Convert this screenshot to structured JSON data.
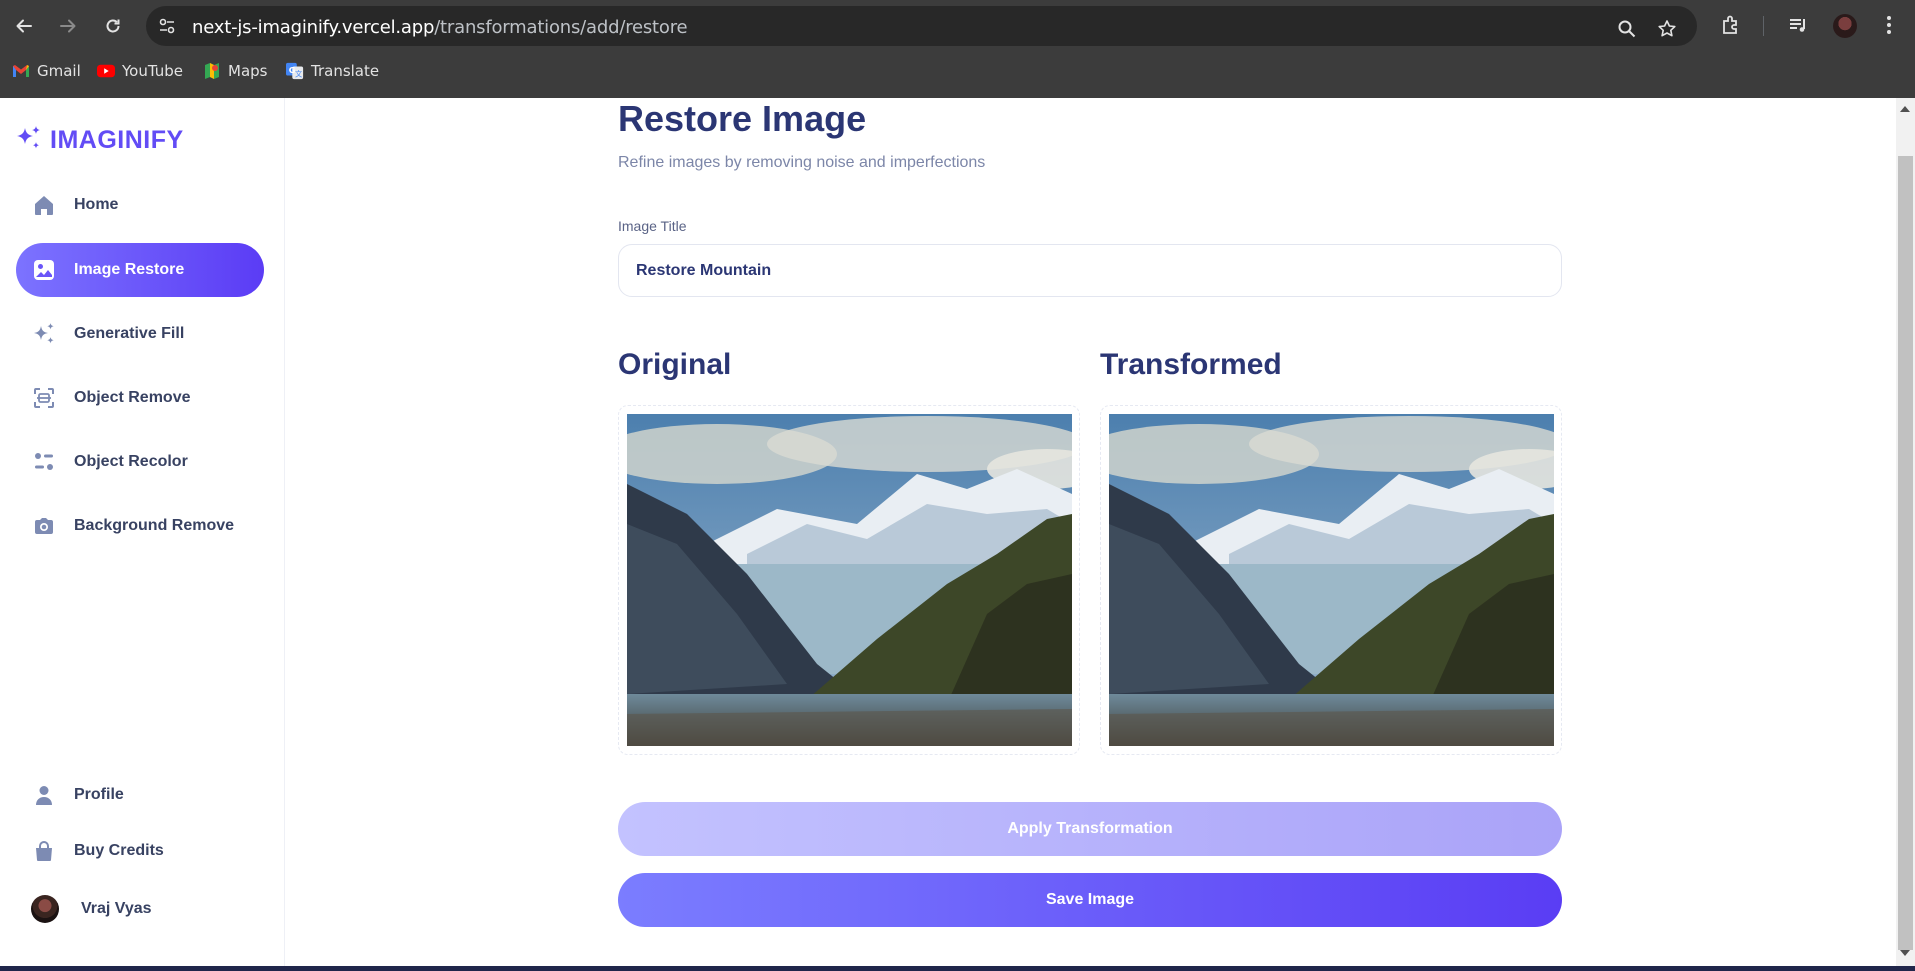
{
  "browser": {
    "url_host": "next-js-imaginify.vercel.app",
    "url_path": "/transformations/add/restore",
    "bookmarks": [
      {
        "label": "Gmail",
        "icon": "gmail-icon"
      },
      {
        "label": "YouTube",
        "icon": "youtube-icon"
      },
      {
        "label": "Maps",
        "icon": "maps-icon"
      },
      {
        "label": "Translate",
        "icon": "translate-icon"
      }
    ]
  },
  "sidebar": {
    "logo": "IMAGINIFY",
    "items": [
      {
        "label": "Home",
        "icon": "home-icon",
        "active": false
      },
      {
        "label": "Image Restore",
        "icon": "image-icon",
        "active": true
      },
      {
        "label": "Generative Fill",
        "icon": "stars-icon",
        "active": false
      },
      {
        "label": "Object Remove",
        "icon": "scan-icon",
        "active": false
      },
      {
        "label": "Object Recolor",
        "icon": "filter-icon",
        "active": false
      },
      {
        "label": "Background Remove",
        "icon": "camera-icon",
        "active": false
      }
    ],
    "bottom_items": [
      {
        "label": "Profile",
        "icon": "profile-icon"
      },
      {
        "label": "Buy Credits",
        "icon": "bag-icon"
      }
    ],
    "user": {
      "name": "Vraj Vyas"
    }
  },
  "main": {
    "title": "Restore Image",
    "subtitle": "Refine images by removing noise and imperfections",
    "image_title_label": "Image Title",
    "image_title_value": "Restore Mountain",
    "original_label": "Original",
    "transformed_label": "Transformed",
    "apply_button": "Apply Transformation",
    "save_button": "Save Image"
  },
  "colors": {
    "accent": "#624cf5",
    "active_gradient_start": "#7c73ff",
    "active_gradient_end": "#5b3cf5",
    "heading": "#2b3674",
    "apply_button": "#b9b4fc",
    "save_button": "#6a5cfa"
  }
}
